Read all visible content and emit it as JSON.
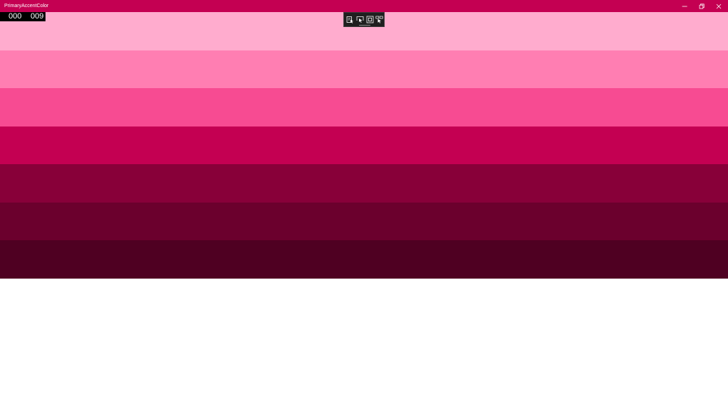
{
  "window": {
    "title": "PrimaryAccentColor",
    "titlebar_color": "#c40052",
    "controls": [
      {
        "name": "minimize",
        "icon": "minimize-icon"
      },
      {
        "name": "restore",
        "icon": "restore-icon"
      },
      {
        "name": "close",
        "icon": "close-icon"
      }
    ]
  },
  "frame_counter": {
    "left": "000",
    "right": "009"
  },
  "debug_toolbar": {
    "buttons": [
      {
        "icon": "select-element-icon"
      },
      {
        "icon": "pointer-icon"
      },
      {
        "icon": "layout-bounds-icon"
      },
      {
        "icon": "track-focused-element-icon"
      }
    ]
  },
  "accent_shades": [
    {
      "name": "light3",
      "color": "#ffacce"
    },
    {
      "name": "light2",
      "color": "#ff7eb2"
    },
    {
      "name": "light1",
      "color": "#f74b92"
    },
    {
      "name": "accent",
      "color": "#c40052"
    },
    {
      "name": "dark1",
      "color": "#880039"
    },
    {
      "name": "dark2",
      "color": "#6b002d"
    },
    {
      "name": "dark3",
      "color": "#4f0022"
    }
  ]
}
